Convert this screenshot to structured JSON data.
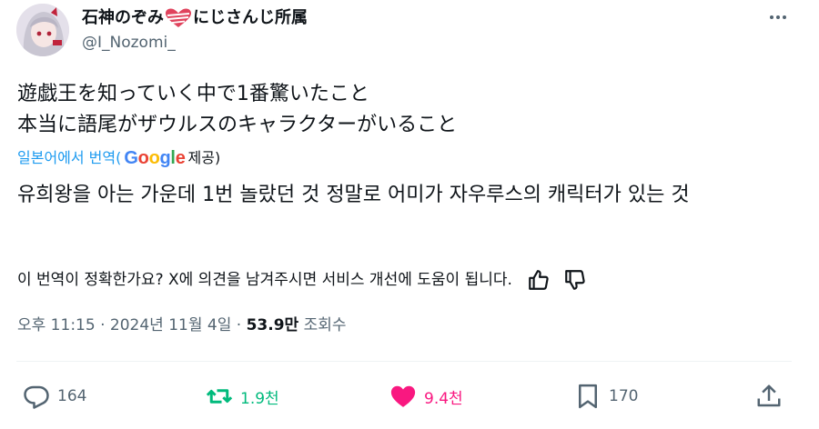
{
  "author": {
    "display_name_prefix": "石神のぞみ",
    "display_name_suffix": "にじさんじ所属",
    "handle": "@I_Nozomi_"
  },
  "tweet": {
    "lines": [
      "遊戯王を知っていく中で1番驚いたこと",
      "本当に語尾がザウルスのキャラクターがいること"
    ]
  },
  "translation": {
    "link_text": "일본어에서 번역",
    "open_paren": "(",
    "provider": "Google",
    "suffix": " 제공)",
    "text": "유희왕을 아는 가운데 1번 놀랐던 것 정말로 어미가 자우루스의 캐릭터가 있는 것",
    "feedback_prompt": "이 번역이 정확한가요? X에 의견을 남겨주시면 서비스 개선에 도움이 됩니다."
  },
  "meta": {
    "time": "오후 11:15",
    "separator": " · ",
    "date": "2024년 11월 4일",
    "views_count": "53.9만",
    "views_label": " 조회수"
  },
  "actions": {
    "replies": "164",
    "retweets": "1.9천",
    "likes": "9.4천",
    "bookmarks": "170"
  },
  "colors": {
    "accent_blue": "#1d9bf0",
    "retweet_green": "#00ba7c",
    "like_pink": "#f91880",
    "secondary_text": "#536471"
  },
  "icons": [
    "avatar",
    "heart-badge-icon",
    "more-icon",
    "thumbs-up-icon",
    "thumbs-down-icon",
    "reply-icon",
    "retweet-icon",
    "like-icon",
    "bookmark-icon",
    "share-icon"
  ]
}
